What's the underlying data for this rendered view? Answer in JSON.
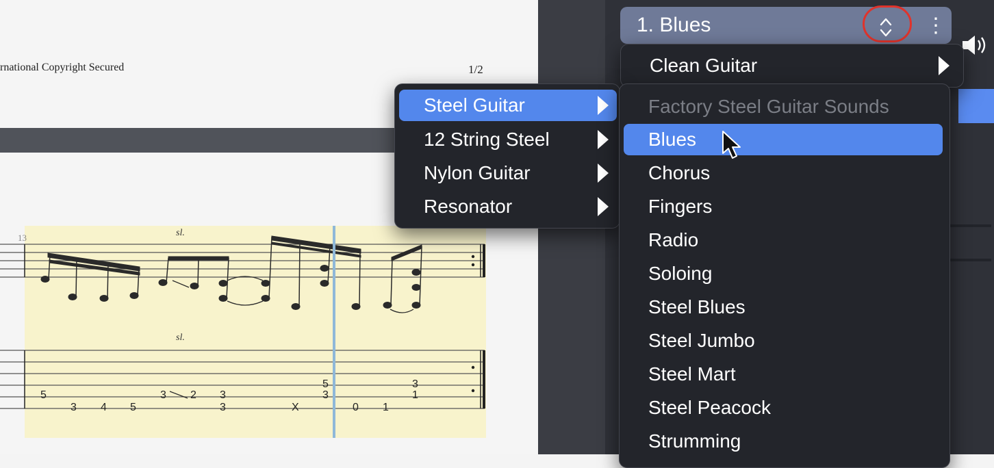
{
  "score": {
    "copyright": "rnational Copyright Secured",
    "page_number": "1/2",
    "measure_number": "13",
    "slide_marks": [
      "sl.",
      "sl."
    ],
    "tab_numbers": [
      "5",
      "3",
      "4",
      "5",
      "3",
      "2",
      "3",
      "3",
      "X",
      "5",
      "3",
      "0",
      "1",
      "3",
      "1"
    ]
  },
  "track": {
    "title": "1. Blues",
    "updown_icon": "chevron-updown-icon",
    "more_icon": "vertical-ellipsis-icon",
    "more_label": "⋮",
    "speaker_icon": "speaker-icon"
  },
  "menus": {
    "top": {
      "items": [
        {
          "label": "Clean Guitar",
          "has_submenu": true
        }
      ]
    },
    "categories": {
      "items": [
        {
          "label": "Steel Guitar",
          "has_submenu": true,
          "active": true
        },
        {
          "label": "12 String Steel",
          "has_submenu": true
        },
        {
          "label": "Nylon Guitar",
          "has_submenu": true
        },
        {
          "label": "Resonator",
          "has_submenu": true
        }
      ]
    },
    "presets": {
      "header": "Factory Steel Guitar Sounds",
      "items": [
        {
          "label": "Blues",
          "active": true
        },
        {
          "label": "Chorus"
        },
        {
          "label": "Fingers"
        },
        {
          "label": "Radio"
        },
        {
          "label": "Soloing"
        },
        {
          "label": "Steel Blues"
        },
        {
          "label": "Steel Jumbo"
        },
        {
          "label": "Steel Mart"
        },
        {
          "label": "Steel Peacock"
        },
        {
          "label": "Strumming"
        }
      ]
    }
  },
  "colors": {
    "accent": "#5387ec",
    "menu_bg": "#23252b",
    "track_header": "#6f7a98",
    "annotation_ring": "#e0332b"
  }
}
